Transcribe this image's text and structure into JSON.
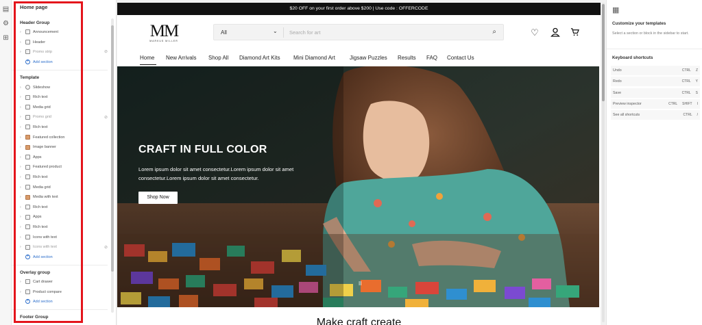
{
  "rail": {
    "icons": [
      "sections-icon",
      "settings-icon",
      "apps-icon"
    ]
  },
  "sections_panel": {
    "title": "Home page",
    "header_group": {
      "title": "Header Group",
      "items": [
        {
          "label": "Announcement",
          "icon": "section-icon"
        },
        {
          "label": "Header",
          "icon": "section-icon"
        },
        {
          "label": "Promo strip",
          "icon": "section-icon",
          "hidden": true
        }
      ],
      "add_label": "Add section"
    },
    "template": {
      "title": "Template",
      "items": [
        {
          "label": "Slideshow",
          "icon": "slideshow-icon"
        },
        {
          "label": "Rich text",
          "icon": "section-icon"
        },
        {
          "label": "Media grid",
          "icon": "section-icon"
        },
        {
          "label": "Promo grid",
          "icon": "section-icon",
          "hidden": true
        },
        {
          "label": "Rich text",
          "icon": "section-icon"
        },
        {
          "label": "Featured collection",
          "icon": "image-icon"
        },
        {
          "label": "Image banner",
          "icon": "image-icon"
        },
        {
          "label": "Apps",
          "icon": "section-icon"
        },
        {
          "label": "Featured product",
          "icon": "section-icon"
        },
        {
          "label": "Rich text",
          "icon": "section-icon"
        },
        {
          "label": "Media grid",
          "icon": "section-icon"
        },
        {
          "label": "Media with text",
          "icon": "image-icon"
        },
        {
          "label": "Rich text",
          "icon": "section-icon"
        },
        {
          "label": "Apps",
          "icon": "section-icon"
        },
        {
          "label": "Rich text",
          "icon": "section-icon"
        },
        {
          "label": "Icons with text",
          "icon": "section-icon"
        },
        {
          "label": "Icons with text",
          "icon": "section-icon",
          "hidden": true
        }
      ],
      "add_label": "Add section"
    },
    "overlay_group": {
      "title": "Overlay group",
      "items": [
        {
          "label": "Cart drawer",
          "icon": "section-icon"
        },
        {
          "label": "Product compare",
          "icon": "section-icon"
        }
      ],
      "add_label": "Add section"
    },
    "footer_group": {
      "title": "Footer Group"
    }
  },
  "store": {
    "announcement": "$20 OFF on your first order above $200 | Use code : OFFERCODE",
    "logo_mark": "MM",
    "logo_sub": "MARKUS MILLER",
    "search": {
      "category": "All",
      "placeholder": "Search for art"
    },
    "nav": [
      "Home",
      "New Arrivals",
      "Shop All",
      "Diamond Art Kits",
      "Mini Diamond Art",
      "Jigsaw Puzzles",
      "Results",
      "FAQ",
      "Contact Us"
    ],
    "hero": {
      "title": "CRAFT IN FULL COLOR",
      "text": "Lorem ipsum dolor sit amet consectetur.Lorem ipsum dolor sit amet consectetur.Lorem ipsum dolor sit amet consectetur.",
      "button": "Shop Now",
      "pause": "II"
    },
    "next_heading": "Make craft create"
  },
  "right_panel": {
    "title": "Customize your templates",
    "description": "Select a section or block in the sidebar to start.",
    "shortcuts_title": "Keyboard shortcuts",
    "shortcuts": [
      {
        "label": "Undo",
        "keys": [
          "CTRL",
          "Z"
        ]
      },
      {
        "label": "Redo",
        "keys": [
          "CTRL",
          "Y"
        ]
      },
      {
        "label": "Save",
        "keys": [
          "CTRL",
          "S"
        ]
      },
      {
        "label": "Preview inspector",
        "keys": [
          "CTRL",
          "SHIFT",
          "I"
        ]
      },
      {
        "label": "See all shortcuts",
        "keys": [
          "CTRL",
          "/"
        ]
      }
    ]
  },
  "colors": {
    "highlight": "#e4141b",
    "link": "#2c6ecb",
    "announcement_bg": "#111111"
  }
}
